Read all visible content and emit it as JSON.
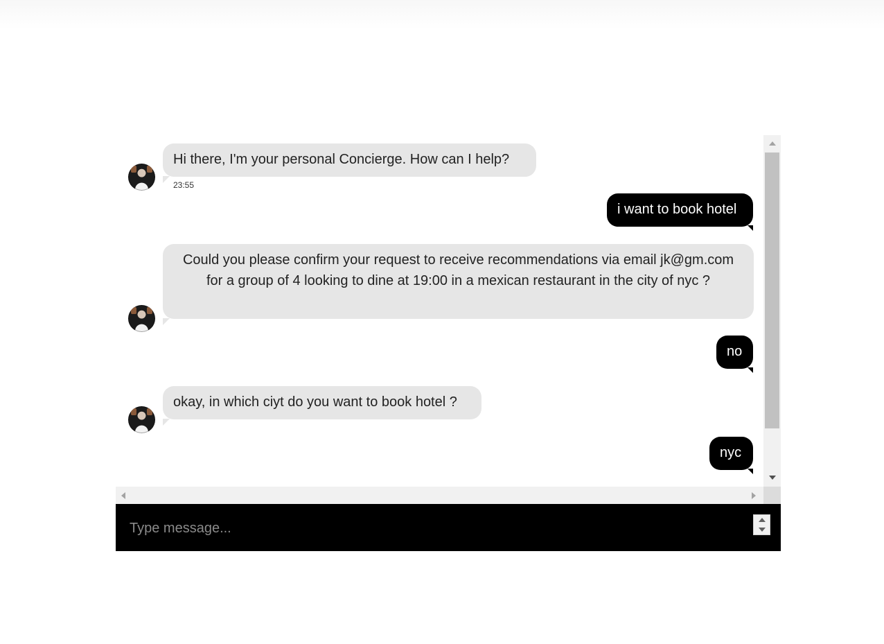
{
  "chat": {
    "messages": [
      {
        "sender": "bot",
        "text": "Hi there, I'm your personal Concierge. How can I help?",
        "time": "23:55"
      },
      {
        "sender": "user",
        "text": "i want to book hotel"
      },
      {
        "sender": "bot",
        "text": "Could you please confirm your request to receive recommendations via email jk@gm.com for a group of 4 looking to dine at 19:00 in a mexican restaurant in the city of nyc ?"
      },
      {
        "sender": "user",
        "text": "no"
      },
      {
        "sender": "bot",
        "text": "okay, in which ciyt do you want to book hotel ?"
      },
      {
        "sender": "user",
        "text": "nyc"
      }
    ],
    "input": {
      "placeholder": "Type message...",
      "value": ""
    }
  },
  "colors": {
    "bot_bubble": "#e6e6e6",
    "user_bubble": "#000000",
    "input_bar": "#000000"
  }
}
